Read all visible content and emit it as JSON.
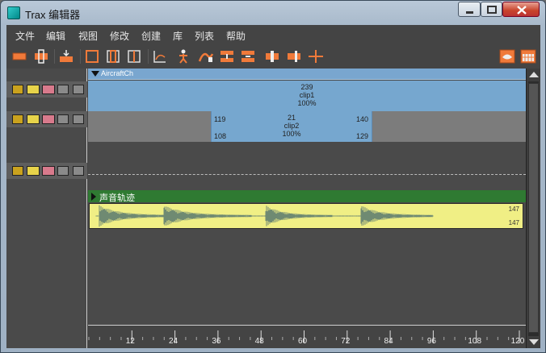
{
  "window": {
    "title": "Trax 编辑器"
  },
  "menu": [
    "文件",
    "编辑",
    "视图",
    "修改",
    "创建",
    "库",
    "列表",
    "帮助"
  ],
  "toolbar": {
    "buttons": [
      "new-clip-icon",
      "new-layer-icon",
      "load-icon",
      "frame-all-icon",
      "frame-left-icon",
      "frame-split-icon",
      "graph-icon",
      "character-icon",
      "blend-icon",
      "insert-icon",
      "remove-icon",
      "split-left-icon",
      "split-right-icon",
      "cut-icon",
      "view-options-icon",
      "calendar-icon"
    ]
  },
  "character": {
    "name": "AircraftCh"
  },
  "clip1": {
    "frames": "239",
    "name": "clip1",
    "scale": "100%"
  },
  "clip2": {
    "frames": "21",
    "name": "clip2",
    "scale": "100%",
    "start_top": "119",
    "start_bottom": "108",
    "end_top": "140",
    "end_bottom": "129"
  },
  "audio": {
    "track_name": "声音轨迹",
    "end_top": "147",
    "end_bottom": "147"
  },
  "ruler": {
    "ticks": [
      "12",
      "24",
      "36",
      "48",
      "60",
      "72",
      "84",
      "96",
      "108",
      "120"
    ]
  }
}
